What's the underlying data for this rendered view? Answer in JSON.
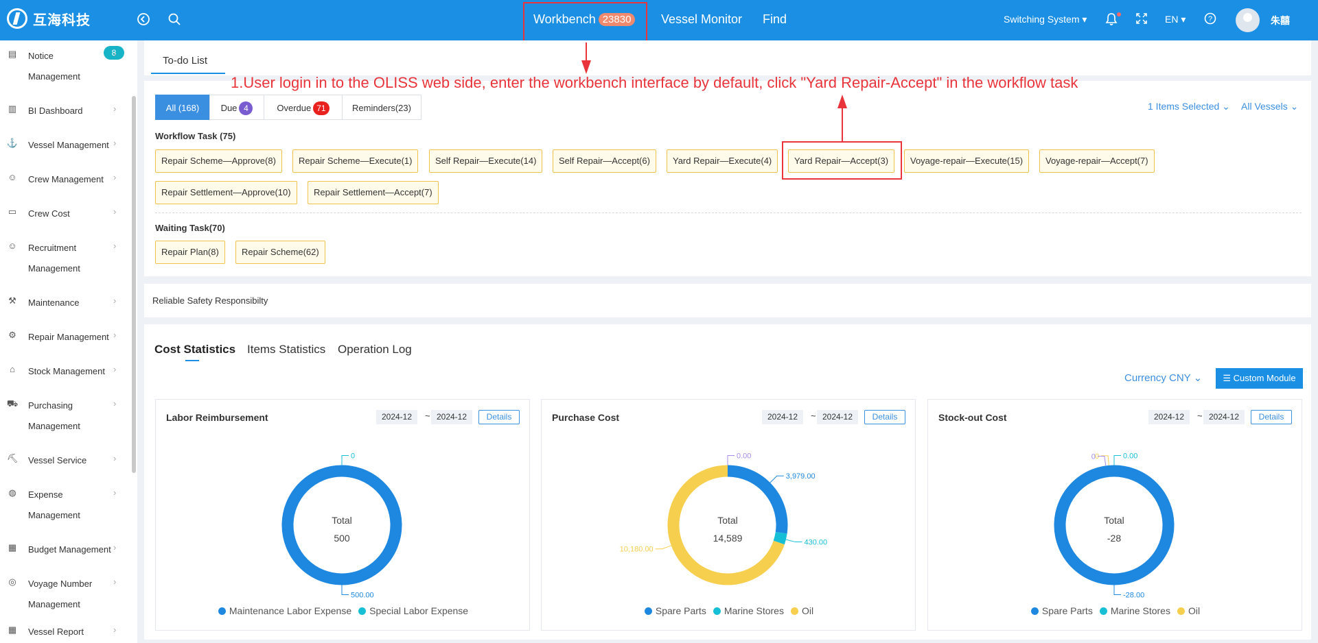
{
  "app": {
    "logo_text": "互海科技"
  },
  "topnav": {
    "workbench": "Workbench",
    "workbench_badge": "23830",
    "vessel_monitor": "Vessel Monitor",
    "find": "Find",
    "switching_system": "Switching System",
    "language": "EN",
    "user_name": "朱囍"
  },
  "sidebar": {
    "notice_badge": "8",
    "items": [
      {
        "line1": "Notice",
        "line2": "Management",
        "icon": "notice-icon"
      },
      {
        "line1": "BI Dashboard",
        "icon": "chart-icon"
      },
      {
        "line1": "Vessel Management",
        "icon": "anchor-icon"
      },
      {
        "line1": "Crew Management",
        "icon": "person-icon"
      },
      {
        "line1": "Crew Cost",
        "icon": "wallet-icon"
      },
      {
        "line1": "Recruitment",
        "line2": "Management",
        "icon": "recruit-icon"
      },
      {
        "line1": "Maintenance",
        "icon": "hammer-icon"
      },
      {
        "line1": "Repair Management",
        "icon": "wrench-icon"
      },
      {
        "line1": "Stock Management",
        "icon": "warehouse-icon"
      },
      {
        "line1": "Purchasing",
        "line2": "Management",
        "icon": "cart-icon"
      },
      {
        "line1": "Vessel Service",
        "icon": "paint-roller-icon"
      },
      {
        "line1": "Expense",
        "line2": "Management",
        "icon": "coins-icon"
      },
      {
        "line1": "Budget Management",
        "icon": "calculator-icon"
      },
      {
        "line1": "Voyage Number",
        "line2": "Management",
        "icon": "globe-icon"
      },
      {
        "line1": "Vessel Report",
        "icon": "report-icon"
      }
    ]
  },
  "todo": {
    "tab": "To-do List",
    "annotation": "1.User login in to the OLISS web side, enter the workbench interface by default, click \"Yard Repair-Accept\" in the workflow task",
    "filters": {
      "all": "All (168)",
      "due": "Due",
      "due_count": "4",
      "overdue": "Overdue",
      "overdue_count": "71",
      "reminders": "Reminders(23)"
    },
    "items_selected": "1 Items Selected",
    "all_vessels": "All Vessels",
    "workflow_title": "Workflow Task (75)",
    "workflow_tasks": [
      "Repair Scheme—Approve(8)",
      "Repair Scheme—Execute(1)",
      "Self Repair—Execute(14)",
      "Self Repair—Accept(6)",
      "Yard Repair—Execute(4)",
      "Yard Repair—Accept(3)",
      "Voyage-repair—Execute(15)",
      "Voyage-repair—Accept(7)",
      "Repair Settlement—Approve(10)",
      "Repair Settlement—Accept(7)"
    ],
    "waiting_title": "Waiting Task(70)",
    "waiting_tasks": [
      "Repair Plan(8)",
      "Repair Scheme(62)"
    ]
  },
  "slogan": "Reliable Safety Responsibilty",
  "stats": {
    "tabs": [
      "Cost Statistics",
      "Items Statistics",
      "Operation Log"
    ],
    "currency": "Currency CNY",
    "custom_module": "Custom Module"
  },
  "colors": {
    "blue": "#1e88e0",
    "cyan": "#17bfd6",
    "yellow": "#f7cf4e",
    "purple": "#a78bea"
  },
  "cards": [
    {
      "title": "Labor Reimbursement",
      "date_from": "2024-12",
      "date_to": "2024-12",
      "details": "Details",
      "total_label": "Total",
      "total": "500",
      "segments": [
        {
          "name": "Maintenance Labor Expense",
          "value": 500,
          "label": "500.00",
          "color": "#1e88e0"
        },
        {
          "name": "Special Labor Expense",
          "value": 0,
          "label": "0",
          "color": "#17bfd6"
        }
      ]
    },
    {
      "title": "Purchase Cost",
      "date_from": "2024-12",
      "date_to": "2024-12",
      "details": "Details",
      "total_label": "Total",
      "total": "14,589",
      "segments": [
        {
          "name": "Spare Parts",
          "value": 3979,
          "label": "3,979.00",
          "color": "#1e88e0"
        },
        {
          "name": "Marine Stores",
          "value": 430,
          "label": "430.00",
          "color": "#17bfd6"
        },
        {
          "name": "Oil",
          "value": 10180,
          "label": "10,180.00",
          "color": "#f7cf4e"
        },
        {
          "name": "",
          "value": 0,
          "label": "0.00",
          "color": "#a78bea"
        }
      ]
    },
    {
      "title": "Stock-out Cost",
      "date_from": "2024-12",
      "date_to": "2024-12",
      "details": "Details",
      "total_label": "Total",
      "total": "-28",
      "segments": [
        {
          "name": "Spare Parts",
          "value": -28,
          "label": "-28.00",
          "color": "#1e88e0"
        },
        {
          "name": "Marine Stores",
          "value": 0,
          "label": "0.00",
          "color": "#17bfd6"
        },
        {
          "name": "Oil",
          "value": 0,
          "label": "0",
          "color": "#f7cf4e"
        },
        {
          "name": "",
          "value": 0,
          "label": "0",
          "color": "#a78bea"
        }
      ]
    }
  ],
  "chart_data": [
    {
      "type": "pie",
      "title": "Labor Reimbursement",
      "categories": [
        "Maintenance Labor Expense",
        "Special Labor Expense"
      ],
      "values": [
        500,
        0
      ]
    },
    {
      "type": "pie",
      "title": "Purchase Cost",
      "categories": [
        "Spare Parts",
        "Marine Stores",
        "Oil"
      ],
      "values": [
        3979,
        430,
        10180
      ]
    },
    {
      "type": "pie",
      "title": "Stock-out Cost",
      "categories": [
        "Spare Parts",
        "Marine Stores",
        "Oil"
      ],
      "values": [
        -28,
        0,
        0
      ]
    }
  ]
}
